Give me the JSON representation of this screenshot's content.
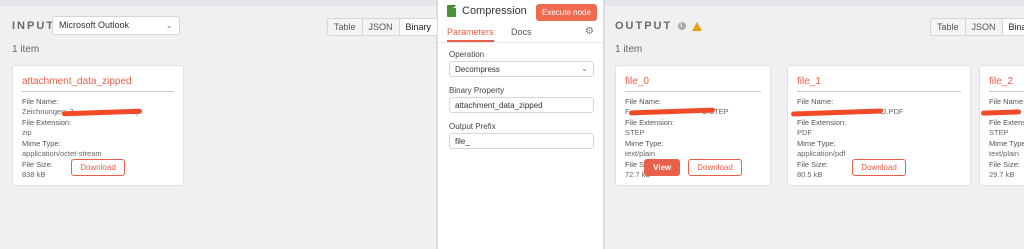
{
  "input": {
    "label": "INPUT",
    "node_select": "Microsoft Outlook",
    "view_tabs": [
      "Table",
      "JSON",
      "Binary"
    ],
    "active_tab": "Binary",
    "item_count": "1 item",
    "card": {
      "file_name_title": "attachment_data_zipped",
      "file_name_label": "File Name:",
      "file_name_value": "Zeichnungen_2",
      "file_name_suffix": ".zip",
      "extension_label": "File Extension:",
      "extension_value": "zip",
      "mime_label": "Mime Type:",
      "mime_value": "application/octet-stream",
      "size_label": "File Size:",
      "size_value": "838 kB",
      "download_label": "Download"
    }
  },
  "node": {
    "title": "Compression",
    "execute_label": "Execute node",
    "tabs": [
      "Parameters",
      "Docs"
    ],
    "operation_label": "Operation",
    "operation_value": "Decompress",
    "binary_property_label": "Binary Property",
    "binary_property_value": "attachment_data_zipped",
    "output_prefix_label": "Output Prefix",
    "output_prefix_value": "file_"
  },
  "output": {
    "label": "OUTPUT",
    "view_tabs": [
      "Table",
      "JSON",
      "Binary"
    ],
    "active_tab": "Binary",
    "item_count": "1 item",
    "cards": [
      {
        "title": "file_0",
        "file_name_label": "File Name:",
        "file_name_value": "F",
        "file_name_suffix": "C.STEP",
        "extension_label": "File Extension:",
        "extension_value": "STEP",
        "mime_label": "Mime Type:",
        "mime_value": "text/plain",
        "size_label": "File Size:",
        "size_value": "72.7 kB",
        "view_label": "View",
        "download_label": "Download"
      },
      {
        "title": "file_1",
        "file_name_label": "File Name:",
        "file_name_value": "",
        "file_name_suffix": "D.PDF",
        "extension_label": "File Extension:",
        "extension_value": "PDF",
        "mime_label": "Mime Type:",
        "mime_value": "application/pdf",
        "size_label": "File Size:",
        "size_value": "80.5 kB",
        "download_label": "Download"
      },
      {
        "title": "file_2",
        "file_name_label": "File Name:",
        "file_name_value": "",
        "file_name_suffix": "",
        "extension_label": "File Extension:",
        "extension_value": "STEP",
        "mime_label": "Mime Type:",
        "mime_value": "text/plain",
        "size_label": "File Size:",
        "size_value": "29.7 kB"
      }
    ]
  },
  "colors": {
    "accent": "#e8604a",
    "redaction": "#f04a28",
    "warning": "#e3a10d"
  }
}
